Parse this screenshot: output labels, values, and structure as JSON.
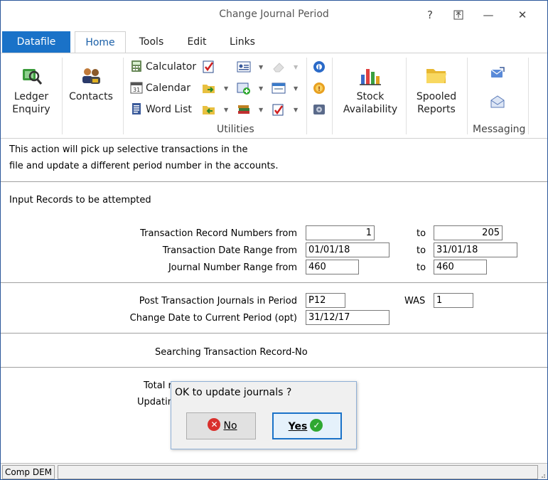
{
  "window": {
    "title": "Change Journal Period",
    "help": "?",
    "restore": "⊼",
    "minimize": "—",
    "close": "✕"
  },
  "tabs": [
    "Datafile",
    "Home",
    "Tools",
    "Edit",
    "Links"
  ],
  "ribbon": {
    "ledger_enquiry": [
      "Ledger",
      "Enquiry"
    ],
    "contacts": "Contacts",
    "calculator": "Calculator",
    "calendar": "Calendar",
    "word_list": "Word List",
    "utilities_label": "Utilities",
    "stock_availability": [
      "Stock",
      "Availability"
    ],
    "spooled_reports": [
      "Spooled",
      "Reports"
    ],
    "messaging_label": "Messaging"
  },
  "content": {
    "description_line1": "This action will pick up selective transactions in the",
    "description_line2": "file and update a different period number in the accounts.",
    "input_records_heading": "Input Records to be attempted",
    "trans_record_label": "Transaction Record Numbers from",
    "trans_record_from": "1",
    "trans_record_to": "205",
    "trans_date_label": "Transaction Date Range from",
    "trans_date_from": "01/01/18",
    "trans_date_to": "31/01/18",
    "journal_label": "Journal Number Range from",
    "journal_from": "460",
    "journal_to": "460",
    "to_label": "to",
    "post_period_label": "Post Transaction Journals in Period",
    "post_period_value": "P12",
    "was_label": "WAS",
    "was_value": "1",
    "change_date_label": "Change Date to Current Period (opt)",
    "change_date_value": "31/12/17",
    "searching_label": "Searching Transaction Record-No",
    "total_label_partial": "Total r",
    "updating_label_partial": "Updatin"
  },
  "dialog": {
    "message": "OK to update journals ?",
    "no_label": "No",
    "yes_label": "Yes"
  },
  "statusbar": {
    "company": "Comp DEM"
  },
  "colors": {
    "accent": "#1a72c8",
    "no_icon": "#d9302c",
    "yes_icon": "#2fa831"
  }
}
